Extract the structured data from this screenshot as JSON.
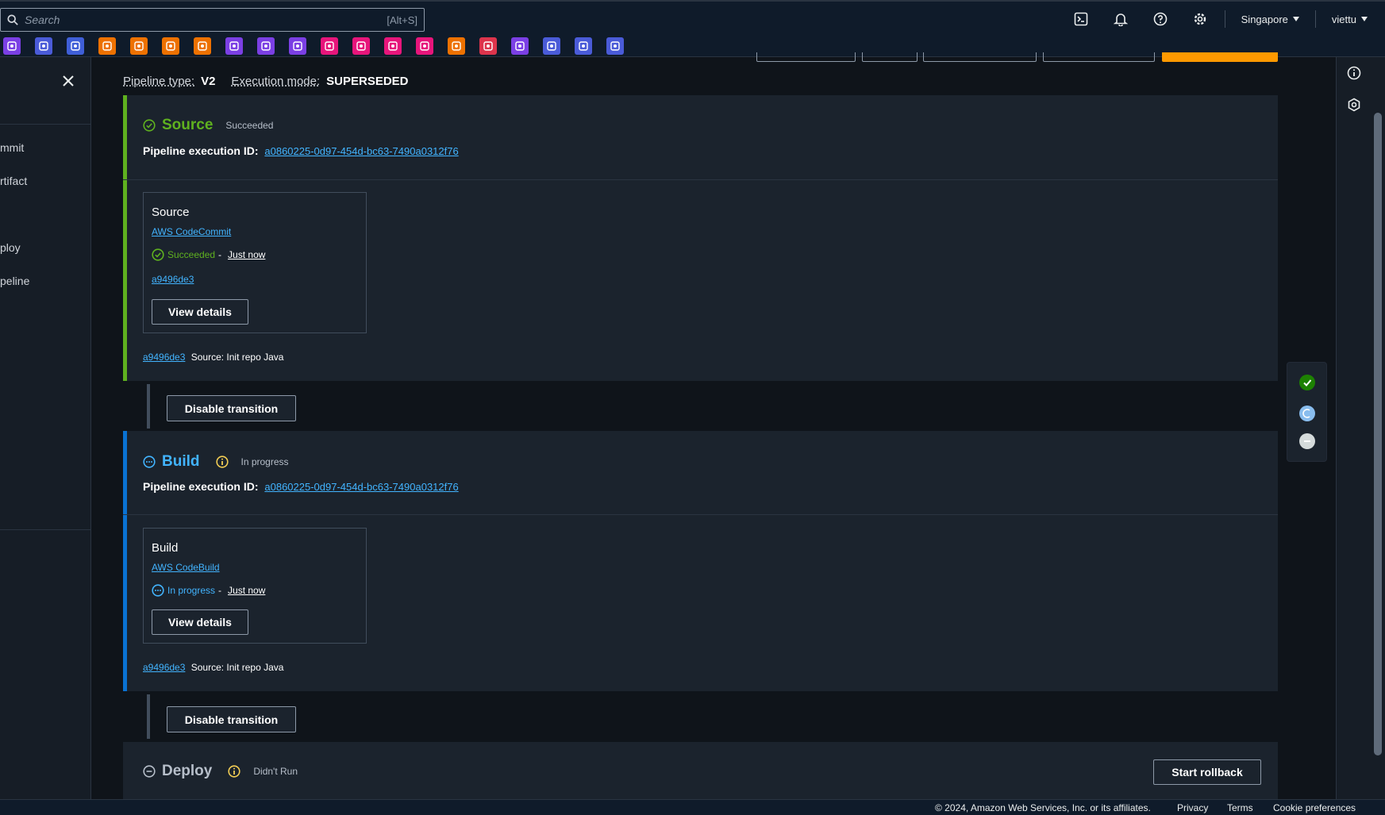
{
  "topbar": {
    "search_placeholder": "Search",
    "search_shortcut": "[Alt+S]",
    "region": "Singapore",
    "user": "viettu"
  },
  "favorites": [
    {
      "icon": "iam-icon",
      "color": "#7b3fe4"
    },
    {
      "icon": "ec2-icon",
      "color": "#4a5bd8"
    },
    {
      "icon": "rds-icon",
      "color": "#3f5fd8"
    },
    {
      "icon": "lambda-icon",
      "color": "#ed7100"
    },
    {
      "icon": "ecs-icon",
      "color": "#ed7100"
    },
    {
      "icon": "eks-icon",
      "color": "#ed7100"
    },
    {
      "icon": "container-icon",
      "color": "#ed7100"
    },
    {
      "icon": "codecommit-icon",
      "color": "#7b3fe4"
    },
    {
      "icon": "kinesis-icon",
      "color": "#7b3fe4"
    },
    {
      "icon": "vpc-icon",
      "color": "#7b3fe4"
    },
    {
      "icon": "eventbridge-icon",
      "color": "#e7157b"
    },
    {
      "icon": "cloudwatch-icon",
      "color": "#e7157b"
    },
    {
      "icon": "sns-icon",
      "color": "#e7157b"
    },
    {
      "icon": "sqs-icon",
      "color": "#e7157b"
    },
    {
      "icon": "api-gateway-icon",
      "color": "#ed7100"
    },
    {
      "icon": "config-icon",
      "color": "#dd344c"
    },
    {
      "icon": "cloud9-icon",
      "color": "#7b3fe4"
    },
    {
      "icon": "codepipeline-icon",
      "color": "#4a5bd8"
    },
    {
      "icon": "codebuild-icon",
      "color": "#4a5bd8"
    },
    {
      "icon": "codedeploy-icon",
      "color": "#4a5bd8"
    }
  ],
  "left_panel": {
    "items": [
      "mmit",
      "rtifact",
      "ploy",
      "peline"
    ]
  },
  "meta": {
    "pipeline_type_label": "Pipeline type:",
    "pipeline_type": "V2",
    "execution_mode_label": "Execution mode:",
    "execution_mode": "SUPERSEDED"
  },
  "stages": {
    "source": {
      "title": "Source",
      "status": "Succeeded",
      "exec_label": "Pipeline execution ID:",
      "exec_id": "a0860225-0d97-454d-bc63-7490a0312f76",
      "action_name": "Source",
      "provider": "AWS CodeCommit",
      "action_status": "Succeeded",
      "action_time": "Just now",
      "commit": "a9496de3",
      "view_details": "View details",
      "foot_commit": "a9496de3",
      "foot_message": "Source: Init repo Java",
      "color": "#5fb11f"
    },
    "build": {
      "title": "Build",
      "status": "In progress",
      "exec_label": "Pipeline execution ID:",
      "exec_id": "a0860225-0d97-454d-bc63-7490a0312f76",
      "action_name": "Build",
      "provider": "AWS CodeBuild",
      "action_status": "In progress",
      "action_time": "Just now",
      "view_details": "View details",
      "foot_commit": "a9496de3",
      "foot_message": "Source: Init repo Java",
      "color": "#42b4ff"
    },
    "deploy": {
      "title": "Deploy",
      "status": "Didn't Run",
      "rollback": "Start rollback"
    }
  },
  "transitions": {
    "label": "Disable transition"
  },
  "footer": {
    "copyright": "© 2024, Amazon Web Services, Inc. or its affiliates.",
    "privacy": "Privacy",
    "terms": "Terms",
    "cookies": "Cookie preferences"
  }
}
